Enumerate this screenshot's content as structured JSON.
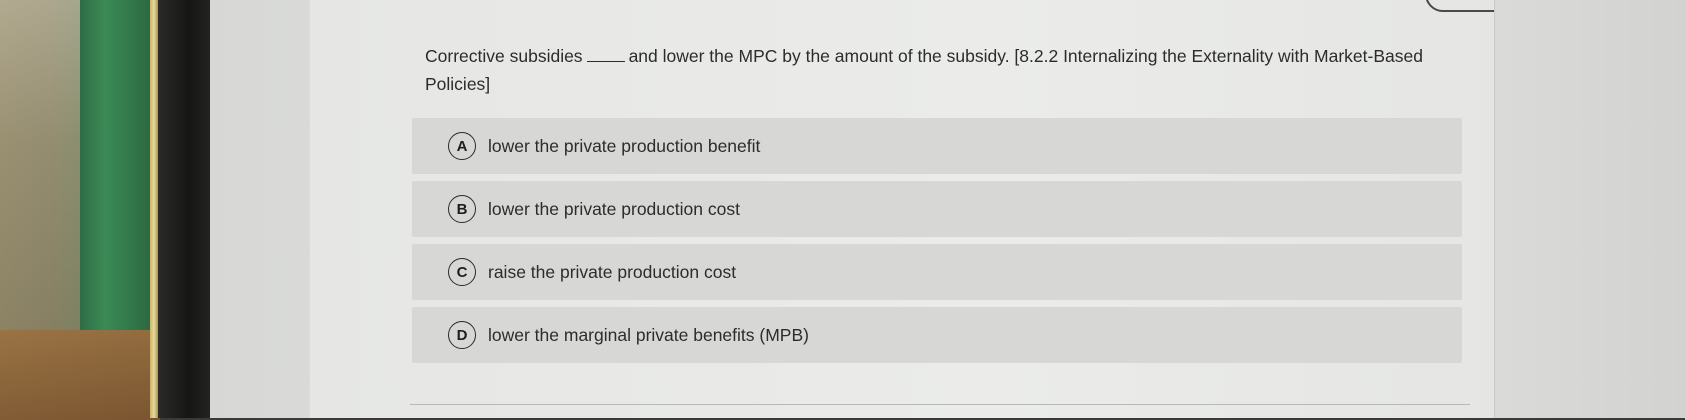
{
  "question": {
    "prefix": "Corrective subsidies",
    "suffix": "and lower the MPC by the amount of the subsidy. [8.2.2 Internalizing the Externality with Market-Based",
    "line2": "Policies]"
  },
  "options": [
    {
      "letter": "A",
      "text": "lower the private production benefit"
    },
    {
      "letter": "B",
      "text": "lower the private production cost"
    },
    {
      "letter": "C",
      "text": "raise the private production cost"
    },
    {
      "letter": "D",
      "text": "lower the marginal private benefits (MPB)"
    }
  ]
}
